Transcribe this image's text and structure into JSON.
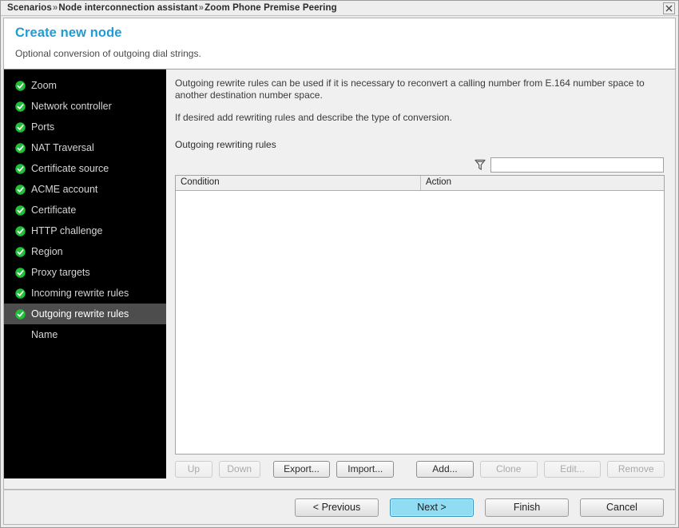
{
  "titlebar": {
    "breadcrumb_parts": [
      "Scenarios",
      "Node interconnection assistant",
      "Zoom Phone Premise Peering"
    ],
    "separator": "»",
    "close_label": "Close"
  },
  "header": {
    "title": "Create new node",
    "subtitle": "Optional conversion of outgoing dial strings."
  },
  "sidebar": {
    "items": [
      {
        "label": "Zoom",
        "done": true,
        "selected": false
      },
      {
        "label": "Network controller",
        "done": true,
        "selected": false
      },
      {
        "label": "Ports",
        "done": true,
        "selected": false
      },
      {
        "label": "NAT Traversal",
        "done": true,
        "selected": false
      },
      {
        "label": "Certificate source",
        "done": true,
        "selected": false
      },
      {
        "label": "ACME account",
        "done": true,
        "selected": false
      },
      {
        "label": "Certificate",
        "done": true,
        "selected": false
      },
      {
        "label": "HTTP challenge",
        "done": true,
        "selected": false
      },
      {
        "label": "Region",
        "done": true,
        "selected": false
      },
      {
        "label": "Proxy targets",
        "done": true,
        "selected": false
      },
      {
        "label": "Incoming rewrite rules",
        "done": true,
        "selected": false
      },
      {
        "label": "Outgoing rewrite rules",
        "done": true,
        "selected": true
      },
      {
        "label": "Name",
        "done": false,
        "selected": false
      }
    ]
  },
  "main": {
    "description_1": "Outgoing rewrite rules can be used if it is necessary to reconvert a calling number from E.164 number space to another destination number space.",
    "description_2": "If desired add rewriting rules and describe the type of conversion.",
    "section_label": "Outgoing rewriting rules",
    "filter": {
      "icon": "funnel-icon",
      "value": "",
      "placeholder": ""
    },
    "table": {
      "columns": [
        "Condition",
        "Action"
      ],
      "rows": []
    },
    "toolbar": [
      {
        "label": "Up",
        "enabled": false
      },
      {
        "label": "Down",
        "enabled": false
      },
      {
        "label": "Export...",
        "enabled": true
      },
      {
        "label": "Import...",
        "enabled": true
      },
      {
        "label": "Add...",
        "enabled": true
      },
      {
        "label": "Clone",
        "enabled": false
      },
      {
        "label": "Edit...",
        "enabled": false
      },
      {
        "label": "Remove",
        "enabled": false
      }
    ]
  },
  "footer": {
    "previous": "< Previous",
    "next": "Next >",
    "finish": "Finish",
    "cancel": "Cancel"
  },
  "colors": {
    "accent_title": "#1f9cd6",
    "primary_button": "#8fdcf3",
    "check_green": "#22c03a",
    "sidebar_bg": "#000000",
    "sidebar_selected": "#4d4d4d"
  }
}
